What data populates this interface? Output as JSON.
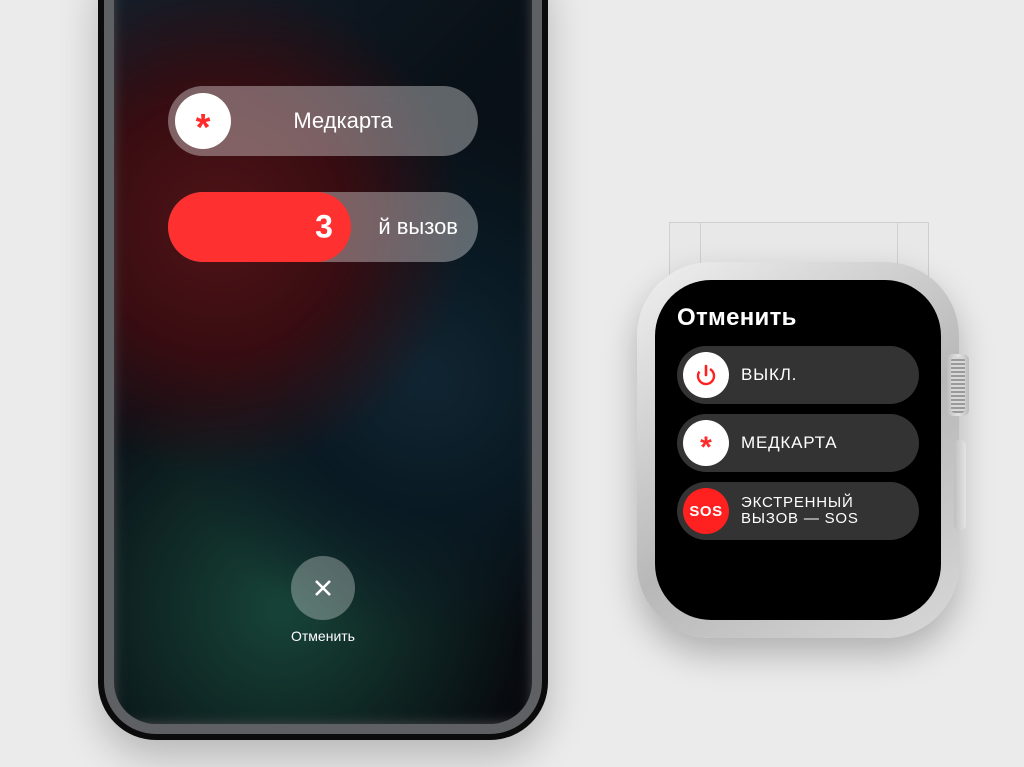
{
  "iphone": {
    "medical_slider": {
      "icon_name": "asterisk-icon",
      "label": "Медкарта"
    },
    "sos_slider": {
      "countdown": "3",
      "remaining_label": "й вызов"
    },
    "cancel": {
      "icon_name": "close-icon",
      "label": "Отменить"
    }
  },
  "watch": {
    "title": "Отменить",
    "sliders": {
      "power": {
        "icon_name": "power-icon",
        "label": "ВЫКЛ."
      },
      "medical": {
        "icon_name": "asterisk-icon",
        "label": "МЕДКАРТА"
      },
      "sos": {
        "icon_name": "sos-icon",
        "knob_text": "SOS",
        "label_line1": "ЭКСТРЕННЫЙ",
        "label_line2": "ВЫЗОВ — SOS"
      }
    }
  }
}
